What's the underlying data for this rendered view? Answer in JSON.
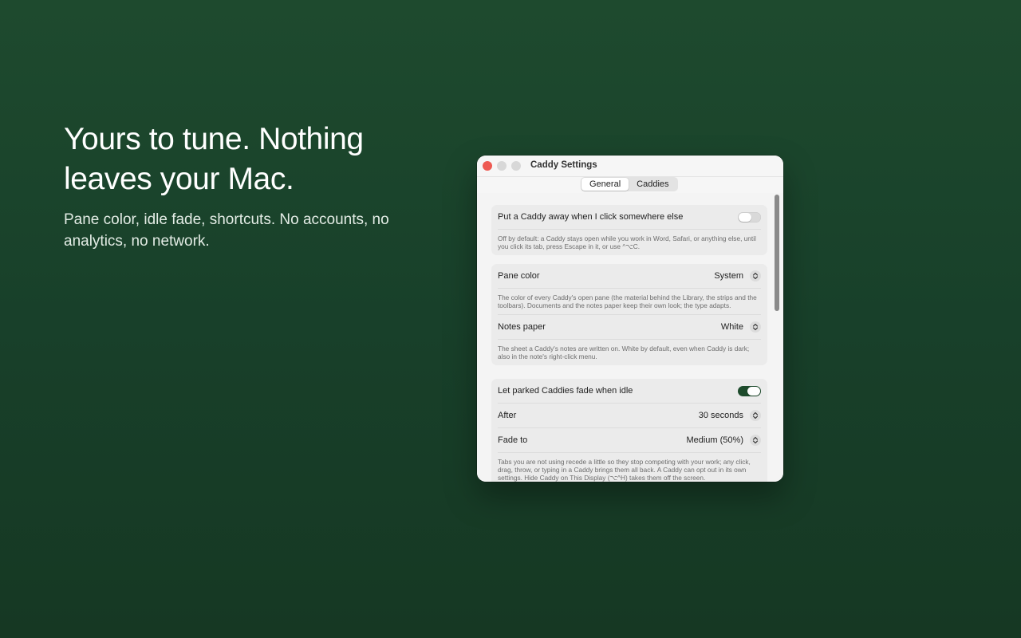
{
  "hero": {
    "headline": "Yours to tune. Nothing leaves your Mac.",
    "subhead": "Pane color, idle fade, shortcuts. No accounts, no analytics, no network."
  },
  "window": {
    "title": "Caddy Settings",
    "tabs": [
      {
        "label": "General",
        "active": true
      },
      {
        "label": "Caddies",
        "active": false
      }
    ]
  },
  "settings": {
    "dismiss": {
      "label": "Put a Caddy away when I click somewhere else",
      "enabled": false,
      "description": "Off by default: a Caddy stays open while you work in Word, Safari, or anything else, until you click its tab, press Escape in it, or use ^⌥C."
    },
    "pane_color": {
      "label": "Pane color",
      "value": "System",
      "description": "The color of every Caddy's open pane (the material behind the Library, the strips and the toolbars). Documents and the notes paper keep their own look; the type adapts."
    },
    "notes_paper": {
      "label": "Notes paper",
      "value": "White",
      "description": "The sheet a Caddy's notes are written on. White by default, even when Caddy is dark; also in the note's right-click menu."
    },
    "fade": {
      "label": "Let parked Caddies fade when idle",
      "enabled": true,
      "after_label": "After",
      "after_value": "30 seconds",
      "fade_to_label": "Fade to",
      "fade_to_value": "Medium (50%)",
      "description": "Tabs you are not using recede a little so they stop competing with your work; any click, drag, throw, or typing in a Caddy brings them all back. A Caddy can opt out in its own settings. Hide Caddy on This Display (⌥^H) takes them off the screen."
    }
  },
  "colors": {
    "background": "#1e4a2e",
    "accent": "#1d4b2c",
    "close": "#ee5a52"
  }
}
